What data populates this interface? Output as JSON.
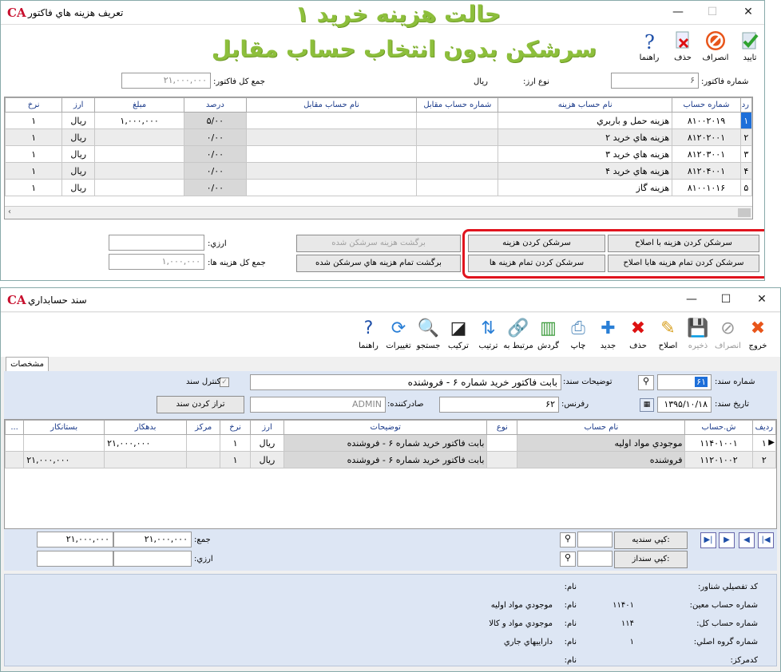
{
  "overlay": {
    "line1": "حالت هزینه خرید ۱",
    "line2": "سرشکن بدون انتخاب حساب مقابل"
  },
  "win1": {
    "title": "تعريف هزينه هاي فاکتور",
    "toolbar": {
      "confirm": "تاييد",
      "cancel": "انصراف",
      "delete": "حذف",
      "help": "راهنما"
    },
    "invoice_no_label": "شماره فاکتور:",
    "invoice_no": "۶",
    "currency_type_label": "نوع ارز:",
    "currency_type": "ريال",
    "invoice_total_label": "جمع کل فاکتور:",
    "invoice_total": "۲۱,۰۰۰,۰۰۰",
    "columns": [
      "رديف",
      "شماره حساب",
      "نام حساب هزينه",
      "شماره حساب مقابل",
      "نام حساب مقابل",
      "درصد",
      "مبلغ",
      "ارز",
      "نرخ"
    ],
    "rows": [
      [
        "۱",
        "۸۱۰۰۲۰۱۹",
        "هزينه حمل و باربري",
        "",
        "",
        "۵/۰۰",
        "۱,۰۰۰,۰۰۰",
        "ريال",
        "۱"
      ],
      [
        "۲",
        "۸۱۲۰۲۰۰۱",
        "هزينه هاي خريد ۲",
        "",
        "",
        "۰/۰۰",
        "",
        "ريال",
        "۱"
      ],
      [
        "۳",
        "۸۱۲۰۳۰۰۱",
        "هزينه هاي خريد ۳",
        "",
        "",
        "۰/۰۰",
        "",
        "ريال",
        "۱"
      ],
      [
        "۴",
        "۸۱۲۰۴۰۰۱",
        "هزينه هاي خريد ۴",
        "",
        "",
        "۰/۰۰",
        "",
        "ريال",
        "۱"
      ],
      [
        "۵",
        "۸۱۰۰۱۰۱۶",
        "هزينه گاز",
        "",
        "",
        "۰/۰۰",
        "",
        "ريال",
        "۱"
      ]
    ],
    "btn_spread_fix": "سرشکن کردن هزينه با اصلاح",
    "btn_spread": "سرشکن کردن هزينه",
    "btn_spread_all_fix": "سرشکن کردن تمام هزينه هابا اصلاح",
    "btn_spread_all": "سرشکن کردن تمام هزينه ها",
    "btn_revert": "برگشت هزينه سرشکن شده",
    "btn_revert_all": "برگشت تمام هزينه هاي سرشکن شده",
    "currency_label": "ارزي:",
    "currency_value": "",
    "total_cost_label": "جمع کل هزينه ها:",
    "total_cost": "۱,۰۰۰,۰۰۰",
    "highlight_color": "#e0141e"
  },
  "win2": {
    "title": "سند حسابداري",
    "toolbar": [
      "خروج",
      "انصراف",
      "ذخيره",
      "اصلاح",
      "حذف",
      "جديد",
      "چاپ",
      "گردش",
      "مرتبط به",
      "ترتيب",
      "ترکيب",
      "جستجو",
      "تغييرات",
      "راهنما"
    ],
    "tab": "مشخصات",
    "doc_no_label": "شماره سند:",
    "doc_no": "۶۱",
    "doc_desc_label": "توضيحات سند:",
    "doc_desc": "بابت فاکتور خريد شماره ۶ - فروشنده",
    "control_label": "کنترل سند",
    "doc_date_label": "تاريخ سند:",
    "doc_date": "۱۳۹۵/۱۰/۱۸",
    "ref_label": "رفرنس:",
    "ref": "۶۲",
    "issuer_label": "صادرکننده:",
    "issuer": "ADMIN",
    "balance_btn": "تراز کردن سند",
    "columns": [
      "رديف",
      "ش.حساب",
      "نام حساب",
      "نوع",
      "توضيحات",
      "ارز",
      "نرخ",
      "مرکز",
      "بدهکار",
      "بستانکار",
      "..."
    ],
    "rows": [
      [
        "۱",
        "۱۱۴۰۱۰۰۱",
        "موجودي مواد اوليه",
        "",
        "بابت فاکتور خريد شماره ۶ - فروشنده",
        "ريال",
        "۱",
        "",
        "۲۱,۰۰۰,۰۰۰",
        "",
        ""
      ],
      [
        "۲",
        "۱۱۲۰۱۰۰۲",
        "فروشنده",
        "",
        "بابت فاکتور خريد شماره ۶ - فروشنده",
        "ريال",
        "۱",
        "",
        "",
        "۲۱,۰۰۰,۰۰۰",
        ""
      ]
    ],
    "sum_label": "جمع:",
    "sum_debit": "۲۱,۰۰۰,۰۰۰",
    "sum_credit": "۲۱,۰۰۰,۰۰۰",
    "cur_label": "ارزي:",
    "copy_from": "کپي سنديه:",
    "copy_to": "کپي سنداز:",
    "info": [
      {
        "label": "کد تفصيلي شناور:",
        "value": "",
        "name_label": "نام:",
        "name": ""
      },
      {
        "label": "شماره حساب معين:",
        "value": "۱۱۴۰۱",
        "name_label": "نام:",
        "name": "موجودي مواد اوليه"
      },
      {
        "label": "شماره حساب کل:",
        "value": "۱۱۴",
        "name_label": "نام:",
        "name": "موجودي مواد و کالا"
      },
      {
        "label": "شماره گروه اصلي:",
        "value": "۱",
        "name_label": "نام:",
        "name": "داراييهاي جاري"
      },
      {
        "label": "کدمرکز:",
        "value": "",
        "name_label": "نام:",
        "name": ""
      }
    ]
  }
}
